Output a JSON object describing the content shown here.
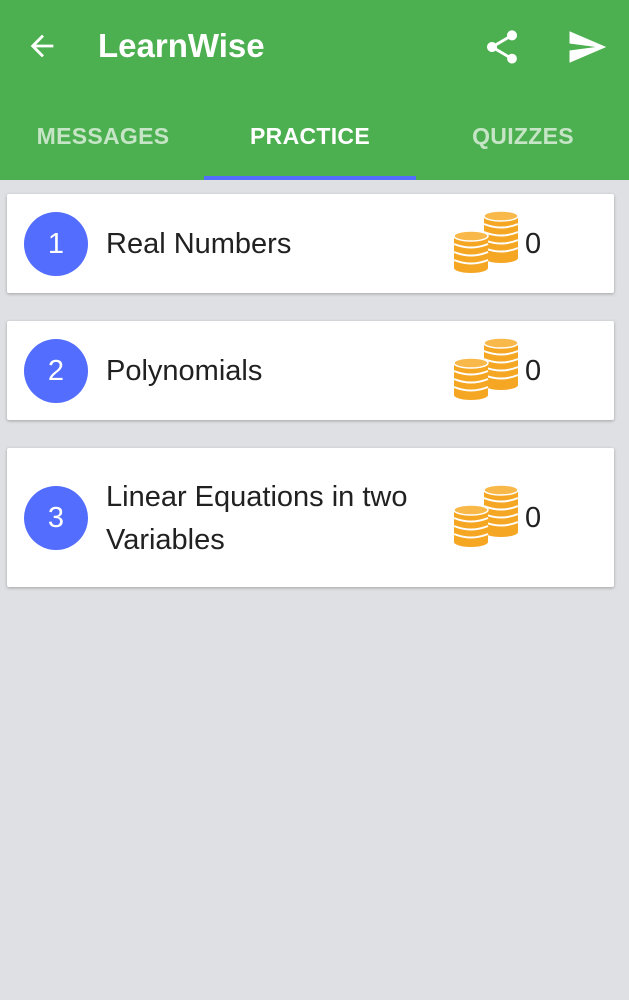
{
  "app": {
    "title": "LearnWise"
  },
  "icons": {
    "back": "arrow-back-icon",
    "share": "share-icon",
    "send": "send-icon",
    "coins": "coins-icon"
  },
  "colors": {
    "appbar": "#4caf50",
    "accent": "#536dfe",
    "background": "#dfe0e3",
    "coin": "#f5a623"
  },
  "tabs": [
    {
      "label": "MESSAGES",
      "active": false
    },
    {
      "label": "PRACTICE",
      "active": true
    },
    {
      "label": "QUIZZES",
      "active": false
    }
  ],
  "chapters": [
    {
      "number": "1",
      "name": "Real Numbers",
      "coins": "0"
    },
    {
      "number": "2",
      "name": "Polynomials",
      "coins": "0"
    },
    {
      "number": "3",
      "name": "Linear Equations in two Variables",
      "coins": "0"
    }
  ]
}
